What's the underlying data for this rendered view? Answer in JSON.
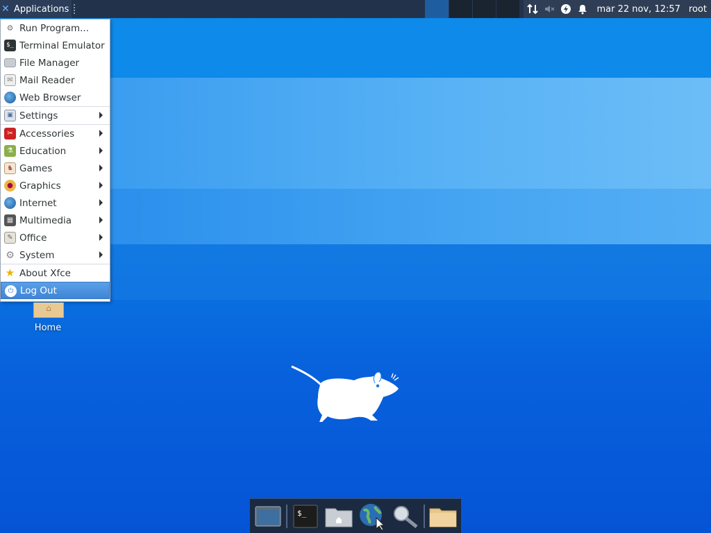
{
  "top_panel": {
    "applications_label": "Applications",
    "clock": "mar 22 nov, 12:57",
    "user": "root",
    "tray_icons": [
      "network-icon",
      "volume-muted-icon",
      "power-icon",
      "notification-bell-icon"
    ]
  },
  "menu": {
    "items": [
      {
        "label": "Run Program...",
        "icon": "run-icon",
        "submenu": false
      },
      {
        "label": "Terminal Emulator",
        "icon": "terminal-icon",
        "submenu": false
      },
      {
        "label": "File Manager",
        "icon": "folder-icon",
        "submenu": false
      },
      {
        "label": "Mail Reader",
        "icon": "mail-icon",
        "submenu": false
      },
      {
        "label": "Web Browser",
        "icon": "globe-icon",
        "submenu": false
      },
      {
        "label": "Settings",
        "icon": "settings-icon",
        "submenu": true
      },
      {
        "label": "Accessories",
        "icon": "accessories-icon",
        "submenu": true
      },
      {
        "label": "Education",
        "icon": "education-icon",
        "submenu": true
      },
      {
        "label": "Games",
        "icon": "games-icon",
        "submenu": true
      },
      {
        "label": "Graphics",
        "icon": "graphics-icon",
        "submenu": true
      },
      {
        "label": "Internet",
        "icon": "internet-icon",
        "submenu": true
      },
      {
        "label": "Multimedia",
        "icon": "multimedia-icon",
        "submenu": true
      },
      {
        "label": "Office",
        "icon": "office-icon",
        "submenu": true
      },
      {
        "label": "System",
        "icon": "system-icon",
        "submenu": true
      },
      {
        "label": "About Xfce",
        "icon": "star-icon",
        "submenu": false
      },
      {
        "label": "Log Out",
        "icon": "logout-icon",
        "submenu": false
      }
    ]
  },
  "desktop": {
    "home_label": "Home"
  },
  "dock": {
    "items": [
      "show-desktop-icon",
      "terminal-icon",
      "home-folder-icon",
      "web-browser-icon",
      "search-icon",
      "folder-icon"
    ]
  },
  "colors": {
    "panel": "#22324a",
    "accent": "#3f85d6",
    "desktop": "#0a7ee4"
  }
}
